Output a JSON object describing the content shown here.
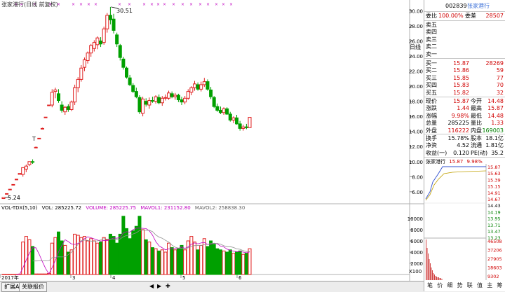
{
  "kline": {
    "title": "张家港行(日线 前复权)",
    "high_label": "30.51",
    "low_label": "5.24",
    "tick_marker": "T",
    "period_label": "日线",
    "y_ticks": [
      "30.00",
      "28.00",
      "26.00",
      "24.00",
      "22.00",
      "20.00",
      "18.00",
      "16.00",
      "14.00",
      "12.00",
      "10.00",
      "8.00",
      "6.00"
    ],
    "y_tick_values": [
      30,
      28,
      26,
      24,
      22,
      20,
      18,
      16,
      14,
      12,
      10,
      8,
      6
    ],
    "x_labels": [
      "2017年",
      "3",
      "4",
      "5",
      "6"
    ]
  },
  "volume": {
    "indicator": "VOL-TDX(5,10)",
    "vol_label": "VOL: 285225.72",
    "volume_label": "VOLUME: 285225.75",
    "mavol1_label": "MAVOL1: 231152.80",
    "mavol2_label": "MAVOL2: 258838.30",
    "y_ticks": [
      "10000",
      "8000",
      "6000",
      "4000",
      "2000"
    ],
    "y_tick_values": [
      10000,
      8000,
      6000,
      4000,
      2000
    ],
    "unit": "X100"
  },
  "chart_data": {
    "type": "candlestick",
    "title": "张家港行(日线 前复权)",
    "ylim": [
      4.5,
      30.5
    ],
    "candles": [
      {
        "o": 5.1,
        "h": 5.24,
        "l": 5.05,
        "c": 5.24,
        "v": 40,
        "up": true
      },
      {
        "o": 5.7,
        "h": 5.76,
        "l": 5.7,
        "c": 5.76,
        "v": 30,
        "up": true
      },
      {
        "o": 6.3,
        "h": 6.34,
        "l": 6.3,
        "c": 6.34,
        "v": 30,
        "up": true
      },
      {
        "o": 6.9,
        "h": 6.97,
        "l": 6.9,
        "c": 6.97,
        "v": 40,
        "up": true
      },
      {
        "o": 7.6,
        "h": 7.67,
        "l": 7.6,
        "c": 7.67,
        "v": 50,
        "up": true
      },
      {
        "o": 8.3,
        "h": 8.44,
        "l": 8.3,
        "c": 8.44,
        "v": 80,
        "up": true
      },
      {
        "o": 8.3,
        "h": 9.2,
        "l": 8.0,
        "c": 9.2,
        "v": 5800,
        "up": true
      },
      {
        "o": 9.0,
        "h": 9.6,
        "l": 8.6,
        "c": 9.4,
        "v": 6800,
        "up": true
      },
      {
        "o": 9.6,
        "h": 10.0,
        "l": 9.4,
        "c": 10.0,
        "v": 6200,
        "up": true
      },
      {
        "o": 10.0,
        "h": 10.3,
        "l": 9.7,
        "c": 9.9,
        "v": 5000,
        "up": false
      },
      {
        "o": 11.9,
        "h": 12.0,
        "l": 11.9,
        "c": 11.9,
        "v": 100,
        "up": true
      },
      {
        "o": 13.1,
        "h": 13.1,
        "l": 13.1,
        "c": 13.1,
        "v": 100,
        "up": true
      },
      {
        "o": 14.4,
        "h": 14.5,
        "l": 14.4,
        "c": 14.4,
        "v": 100,
        "up": true
      },
      {
        "o": 15.9,
        "h": 15.9,
        "l": 15.9,
        "c": 15.9,
        "v": 100,
        "up": true
      },
      {
        "o": 17.5,
        "h": 17.5,
        "l": 17.5,
        "c": 17.5,
        "v": 200,
        "up": true
      },
      {
        "o": 17.5,
        "h": 19.6,
        "l": 17.2,
        "c": 19.2,
        "v": 5600,
        "up": true
      },
      {
        "o": 19.3,
        "h": 19.8,
        "l": 18.4,
        "c": 19.5,
        "v": 6600,
        "up": true
      },
      {
        "o": 19.0,
        "h": 19.6,
        "l": 17.8,
        "c": 18.1,
        "v": 7600,
        "up": false
      },
      {
        "o": 17.5,
        "h": 18.0,
        "l": 16.5,
        "c": 16.8,
        "v": 6000,
        "up": false
      },
      {
        "o": 16.6,
        "h": 17.4,
        "l": 16.2,
        "c": 17.2,
        "v": 5200,
        "up": true
      },
      {
        "o": 17.3,
        "h": 17.6,
        "l": 16.6,
        "c": 16.9,
        "v": 4000,
        "up": false
      },
      {
        "o": 16.9,
        "h": 18.1,
        "l": 16.7,
        "c": 17.9,
        "v": 4400,
        "up": true
      },
      {
        "o": 17.9,
        "h": 20.2,
        "l": 17.5,
        "c": 19.8,
        "v": 7200,
        "up": true
      },
      {
        "o": 19.8,
        "h": 21.2,
        "l": 19.2,
        "c": 20.9,
        "v": 7000,
        "up": true
      },
      {
        "o": 20.9,
        "h": 22.8,
        "l": 20.6,
        "c": 22.4,
        "v": 6600,
        "up": true
      },
      {
        "o": 22.5,
        "h": 23.8,
        "l": 22.0,
        "c": 23.5,
        "v": 6800,
        "up": true
      },
      {
        "o": 23.4,
        "h": 24.6,
        "l": 23.0,
        "c": 24.4,
        "v": 6000,
        "up": true
      },
      {
        "o": 24.4,
        "h": 25.6,
        "l": 23.9,
        "c": 25.4,
        "v": 6400,
        "up": true
      },
      {
        "o": 25.0,
        "h": 26.1,
        "l": 24.6,
        "c": 25.8,
        "v": 6000,
        "up": true
      },
      {
        "o": 25.5,
        "h": 26.6,
        "l": 24.9,
        "c": 26.4,
        "v": 5600,
        "up": true
      },
      {
        "o": 26.0,
        "h": 26.5,
        "l": 25.2,
        "c": 25.6,
        "v": 5800,
        "up": false
      },
      {
        "o": 25.8,
        "h": 27.9,
        "l": 25.5,
        "c": 27.6,
        "v": 6600,
        "up": true
      },
      {
        "o": 27.6,
        "h": 29.7,
        "l": 27.1,
        "c": 29.4,
        "v": 6200,
        "up": true
      },
      {
        "o": 29.4,
        "h": 30.51,
        "l": 28.2,
        "c": 28.8,
        "v": 7200,
        "up": false
      },
      {
        "o": 28.9,
        "h": 29.6,
        "l": 27.0,
        "c": 27.4,
        "v": 6800,
        "up": false
      },
      {
        "o": 26.8,
        "h": 27.1,
        "l": 25.2,
        "c": 25.6,
        "v": 5600,
        "up": false
      },
      {
        "o": 25.4,
        "h": 25.6,
        "l": 23.4,
        "c": 23.8,
        "v": 7200,
        "up": false
      },
      {
        "o": 23.6,
        "h": 23.9,
        "l": 22.2,
        "c": 22.5,
        "v": 10400,
        "up": false
      },
      {
        "o": 22.4,
        "h": 22.6,
        "l": 21.0,
        "c": 21.2,
        "v": 8200,
        "up": false
      },
      {
        "o": 21.1,
        "h": 21.5,
        "l": 20.0,
        "c": 20.2,
        "v": 6400,
        "up": false
      },
      {
        "o": 20.1,
        "h": 20.4,
        "l": 19.1,
        "c": 19.3,
        "v": 7800,
        "up": false
      },
      {
        "o": 19.3,
        "h": 19.8,
        "l": 18.4,
        "c": 18.6,
        "v": 8600,
        "up": false
      },
      {
        "o": 18.5,
        "h": 18.8,
        "l": 16.3,
        "c": 16.6,
        "v": 10400,
        "up": false
      },
      {
        "o": 16.4,
        "h": 18.6,
        "l": 16.0,
        "c": 18.3,
        "v": 8000,
        "up": true
      },
      {
        "o": 18.0,
        "h": 18.4,
        "l": 17.3,
        "c": 17.6,
        "v": 6200,
        "up": false
      },
      {
        "o": 17.5,
        "h": 18.5,
        "l": 17.0,
        "c": 18.1,
        "v": 5800,
        "up": true
      },
      {
        "o": 18.1,
        "h": 18.6,
        "l": 17.8,
        "c": 18.0,
        "v": 4800,
        "up": false
      },
      {
        "o": 18.0,
        "h": 18.8,
        "l": 17.7,
        "c": 18.6,
        "v": 4600,
        "up": true
      },
      {
        "o": 18.5,
        "h": 18.9,
        "l": 17.6,
        "c": 17.8,
        "v": 4200,
        "up": false
      },
      {
        "o": 17.8,
        "h": 18.7,
        "l": 17.4,
        "c": 18.4,
        "v": 4400,
        "up": true
      },
      {
        "o": 18.4,
        "h": 18.9,
        "l": 18.1,
        "c": 18.5,
        "v": 4000,
        "up": true
      },
      {
        "o": 18.4,
        "h": 19.4,
        "l": 18.2,
        "c": 19.1,
        "v": 5600,
        "up": true
      },
      {
        "o": 19.0,
        "h": 19.3,
        "l": 18.4,
        "c": 18.6,
        "v": 4800,
        "up": false
      },
      {
        "o": 18.6,
        "h": 19.1,
        "l": 18.2,
        "c": 18.8,
        "v": 4400,
        "up": true
      },
      {
        "o": 18.8,
        "h": 19.0,
        "l": 17.9,
        "c": 18.2,
        "v": 4600,
        "up": false
      },
      {
        "o": 18.2,
        "h": 18.6,
        "l": 17.5,
        "c": 17.9,
        "v": 5200,
        "up": false
      },
      {
        "o": 17.9,
        "h": 18.7,
        "l": 17.6,
        "c": 18.4,
        "v": 4400,
        "up": true
      },
      {
        "o": 18.4,
        "h": 19.6,
        "l": 18.2,
        "c": 19.3,
        "v": 6000,
        "up": true
      },
      {
        "o": 19.2,
        "h": 20.0,
        "l": 18.8,
        "c": 19.8,
        "v": 6800,
        "up": true
      },
      {
        "o": 19.8,
        "h": 20.7,
        "l": 19.4,
        "c": 20.3,
        "v": 5800,
        "up": true
      },
      {
        "o": 20.2,
        "h": 20.5,
        "l": 19.4,
        "c": 19.6,
        "v": 4400,
        "up": false
      },
      {
        "o": 19.6,
        "h": 20.6,
        "l": 19.3,
        "c": 20.2,
        "v": 5200,
        "up": true
      },
      {
        "o": 20.2,
        "h": 21.1,
        "l": 19.9,
        "c": 20.6,
        "v": 6400,
        "up": true
      },
      {
        "o": 20.6,
        "h": 20.9,
        "l": 19.4,
        "c": 19.6,
        "v": 5000,
        "up": false
      },
      {
        "o": 19.5,
        "h": 19.9,
        "l": 18.3,
        "c": 18.6,
        "v": 6000,
        "up": false
      },
      {
        "o": 18.5,
        "h": 18.7,
        "l": 17.1,
        "c": 17.3,
        "v": 5400,
        "up": false
      },
      {
        "o": 17.3,
        "h": 17.7,
        "l": 16.6,
        "c": 16.8,
        "v": 4600,
        "up": false
      },
      {
        "o": 16.8,
        "h": 17.3,
        "l": 16.3,
        "c": 16.5,
        "v": 4400,
        "up": false
      },
      {
        "o": 16.5,
        "h": 17.2,
        "l": 16.2,
        "c": 17.0,
        "v": 4200,
        "up": true
      },
      {
        "o": 17.0,
        "h": 17.2,
        "l": 16.2,
        "c": 16.3,
        "v": 4000,
        "up": false
      },
      {
        "o": 16.3,
        "h": 16.6,
        "l": 15.3,
        "c": 15.5,
        "v": 4400,
        "up": false
      },
      {
        "o": 15.5,
        "h": 16.0,
        "l": 15.1,
        "c": 15.8,
        "v": 3800,
        "up": true
      },
      {
        "o": 15.8,
        "h": 16.2,
        "l": 14.9,
        "c": 15.0,
        "v": 4000,
        "up": false
      },
      {
        "o": 15.0,
        "h": 15.4,
        "l": 14.1,
        "c": 14.4,
        "v": 4200,
        "up": false
      },
      {
        "o": 14.4,
        "h": 14.9,
        "l": 14.1,
        "c": 14.6,
        "v": 3600,
        "up": true
      },
      {
        "o": 14.6,
        "h": 15.0,
        "l": 14.3,
        "c": 14.5,
        "v": 3800,
        "up": false
      },
      {
        "o": 14.5,
        "h": 15.9,
        "l": 14.5,
        "c": 15.87,
        "v": 4600,
        "up": true
      }
    ]
  },
  "panel": {
    "code": "002839",
    "name": "张家港行",
    "weibi_label": "委比",
    "weibi_value": "100.00%",
    "weicha_label": "委差",
    "weicha_value": "28507",
    "sells": [
      {
        "label": "卖五",
        "price": "",
        "vol": ""
      },
      {
        "label": "卖四",
        "price": "",
        "vol": ""
      },
      {
        "label": "卖三",
        "price": "",
        "vol": ""
      },
      {
        "label": "卖二",
        "price": "",
        "vol": ""
      },
      {
        "label": "卖一",
        "price": "",
        "vol": ""
      }
    ],
    "buys": [
      {
        "label": "买一",
        "price": "15.87",
        "vol": "28269"
      },
      {
        "label": "买二",
        "price": "15.86",
        "vol": "59"
      },
      {
        "label": "买三",
        "price": "15.85",
        "vol": "77"
      },
      {
        "label": "买四",
        "price": "15.83",
        "vol": "70"
      },
      {
        "label": "买五",
        "price": "15.82",
        "vol": "32"
      }
    ],
    "stats": [
      {
        "l1": "现价",
        "v1": "15.87",
        "l2": "今开",
        "v2": "14.48",
        "c1": "#d00000",
        "c2": "#d00000"
      },
      {
        "l1": "涨跌",
        "v1": "1.44",
        "l2": "最高",
        "v2": "15.87",
        "c1": "#d00000",
        "c2": "#d00000"
      },
      {
        "l1": "涨幅",
        "v1": "9.98%",
        "l2": "最低",
        "v2": "14.48",
        "c1": "#d00000",
        "c2": "#d00000"
      },
      {
        "l1": "总量",
        "v1": "285225",
        "l2": "量比",
        "v2": "1.33",
        "c1": "#000000",
        "c2": "#d00000"
      },
      {
        "l1": "外盘",
        "v1": "116222",
        "l2": "内盘",
        "v2": "169003",
        "c1": "#d00000",
        "c2": "#008000"
      }
    ],
    "stats2": [
      {
        "l1": "换手",
        "v1": "15.78%",
        "l2": "股本",
        "v2": "18.1亿"
      },
      {
        "l1": "净资",
        "v1": "4.52",
        "l2": "流通",
        "v2": "1.81亿"
      },
      {
        "l1": "收益(一)",
        "v1": "0.120",
        "l2": "PE(动)",
        "v2": "35.2"
      }
    ],
    "mini_header": "张家港行",
    "mini_price": "15.87",
    "mini_pct": "9.98%",
    "mini_price_ticks": [
      "15.87",
      "15.63",
      "15.39",
      "15.15",
      "14.91",
      "14.67",
      "14.43",
      "14.19",
      "13.95",
      "13.71",
      "13.47",
      "13.23"
    ],
    "mini_vol_ticks": [
      "46508",
      "37206",
      "27905",
      "18603",
      "9302"
    ]
  },
  "bottom_tabs": [
    "扩展A",
    "关联报价"
  ],
  "panel_tabs": [
    "笔",
    "价",
    "细",
    "势",
    "联",
    "值",
    "主",
    "筹"
  ]
}
